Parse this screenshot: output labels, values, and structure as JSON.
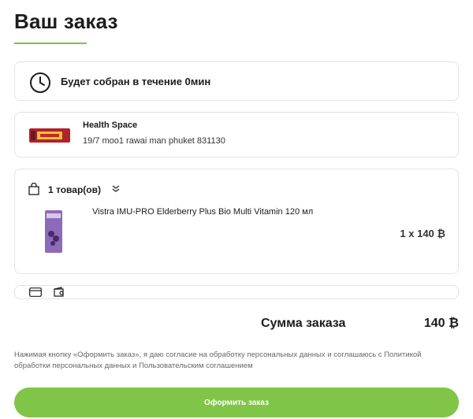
{
  "page": {
    "title": "Ваш заказ"
  },
  "prep": {
    "text": "Будет собран в течение 0мин",
    "icon": "clock-icon"
  },
  "store": {
    "name": "Health Space",
    "address": "19/7 moo1 rawai man phuket 831130",
    "thumb_icon": "store-logo"
  },
  "cart": {
    "count_label": "1 товар(ов)",
    "items": [
      {
        "name": "Vistra IMU-PRO Elderberry Plus Bio Multi Vitamin 120 мл",
        "quantity_price": "1 x 140 ₿"
      }
    ]
  },
  "payment": {
    "icons": [
      "card-icon",
      "wallet-icon"
    ]
  },
  "summary": {
    "total_label": "Сумма заказа",
    "total_value": "140 ₿"
  },
  "consent": "Нажимая кнопку «Оформить заказ», я даю согласие на обработку персональных данных и соглашаюсь с Политикой обработки персональных данных и Пользовательским соглашением",
  "actions": {
    "submit_label": "Оформить заказ"
  },
  "colors": {
    "accent": "#80c547",
    "border": "#e3e3e3"
  }
}
